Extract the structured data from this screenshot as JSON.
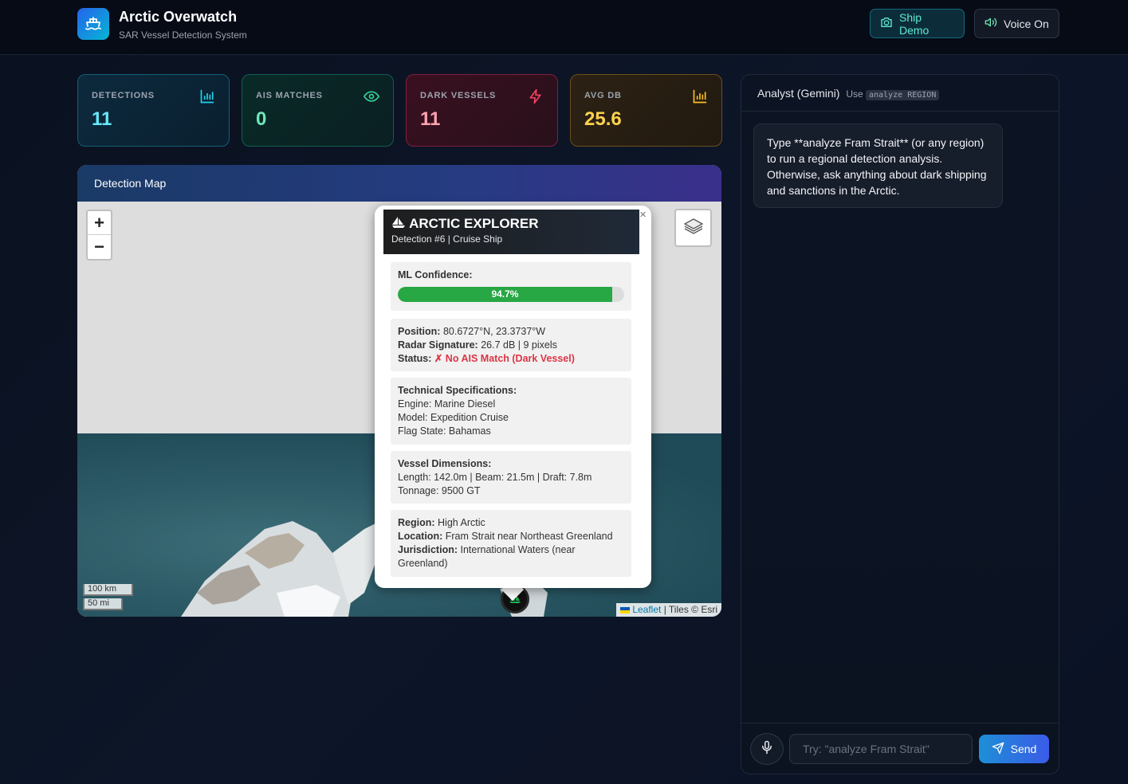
{
  "header": {
    "title": "Arctic Overwatch",
    "subtitle": "SAR Vessel Detection System",
    "logo_icon": "ship-icon",
    "buttons": {
      "demo_label": "Ship Demo",
      "voice_label": "Voice On"
    }
  },
  "stats": [
    {
      "label": "DETECTIONS",
      "value": "11",
      "icon": "bar-chart-icon",
      "color": "#67e8f9"
    },
    {
      "label": "AIS MATCHES",
      "value": "0",
      "icon": "eye-icon",
      "color": "#6ee7b7"
    },
    {
      "label": "DARK VESSELS",
      "value": "11",
      "icon": "lightning-icon",
      "color": "#fda4af"
    },
    {
      "label": "AVG DB",
      "value": "25.6",
      "icon": "bar-chart-icon",
      "color": "#fcd34d"
    }
  ],
  "map": {
    "title": "Detection Map",
    "zoom_in": "+",
    "zoom_out": "−",
    "scale_km": "100 km",
    "scale_mi": "50 mi",
    "attribution_link": "Leaflet",
    "attribution_text": "| Tiles © Esri",
    "popup": {
      "name": "ARCTIC EXPLORER",
      "subtitle": "Detection #6 | Cruise Ship",
      "close": "×",
      "confidence_label": "ML Confidence:",
      "confidence_text": "94.7%",
      "confidence": 0.947,
      "position_label": "Position:",
      "position_value": "80.6727°N, 23.3737°W",
      "radar_label": "Radar Signature:",
      "radar_value": "26.7 dB | 9 pixels",
      "status_label": "Status:",
      "status_value": "✗ No AIS Match (Dark Vessel)",
      "tech_title": "Technical Specifications:",
      "engine": "Engine: Marine Diesel",
      "model": "Model: Expedition Cruise",
      "flag": "Flag State: Bahamas",
      "dims_title": "Vessel Dimensions:",
      "dims": "Length: 142.0m | Beam: 21.5m | Draft: 7.8m",
      "tonnage": "Tonnage: 9500 GT",
      "region_label": "Region:",
      "region_value": "High Arctic",
      "location_label": "Location:",
      "location_value": "Fram Strait near Northeast Greenland",
      "jurisdiction_label": "Jurisdiction:",
      "jurisdiction_value": "International Waters (near Greenland)"
    }
  },
  "chat": {
    "title": "Analyst (Gemini)",
    "hint_prefix": "Use",
    "hint_code": "analyze REGION",
    "message": "Type **analyze Fram Strait** (or any region) to run a regional detection analysis. Otherwise, ask anything about dark shipping and sanctions in the Arctic.",
    "input_placeholder": "Try: \"analyze Fram Strait\"",
    "send_label": "Send"
  }
}
